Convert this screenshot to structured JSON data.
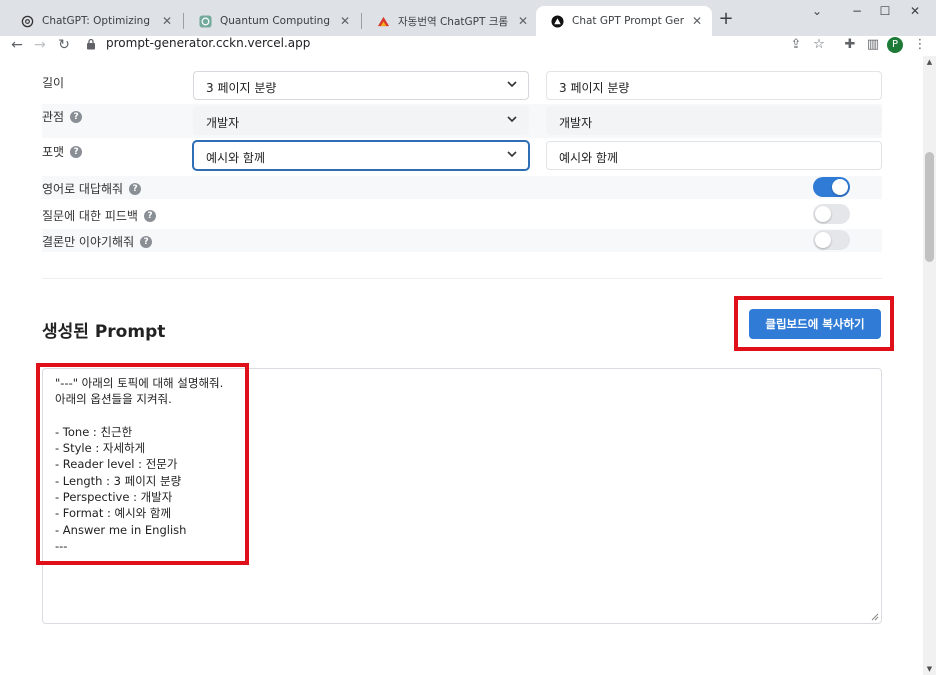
{
  "browser": {
    "tabs": [
      {
        "title": "ChatGPT: Optimizing Language",
        "icon": "openai-icon",
        "active": false
      },
      {
        "title": "Quantum Computing Simplified",
        "icon": "openai-icon",
        "active": false
      },
      {
        "title": "자동번역 ChatGPT 크롬 확장앱",
        "icon": "extension-app-icon",
        "active": false
      },
      {
        "title": "Chat GPT Prompt Generator",
        "icon": "triangle-logo-icon",
        "active": true
      }
    ],
    "url": "prompt-generator.cckn.vercel.app",
    "profile_initial": "P",
    "window_controls": [
      "⌄",
      "−",
      "☐",
      "✕"
    ]
  },
  "options": {
    "length": {
      "label": "길이",
      "value": "3 페이지 분량",
      "preview": "3 페이지 분량"
    },
    "perspective": {
      "label": "관점",
      "value": "개발자",
      "preview": "개발자"
    },
    "format": {
      "label": "포맷",
      "value": "예시와 함께",
      "preview": "예시와 함께"
    },
    "toggles": [
      {
        "label": "영어로 대답해줘",
        "on": true
      },
      {
        "label": "질문에 대한 피드백",
        "on": false
      },
      {
        "label": "결론만 이야기해줘",
        "on": false
      }
    ]
  },
  "result": {
    "title": "생성된 Prompt",
    "copy_label": "클립보드에 복사하기",
    "prompt_lines": [
      "\"---\" 아래의 토픽에 대해 설명해줘.",
      "아래의 옵션들을 지켜줘.",
      "",
      "- Tone : 친근한",
      "- Style : 자세하게",
      "- Reader level : 전문가",
      "- Length : 3 페이지 분량",
      "- Perspective : 개발자",
      "- Format : 예시와 함께",
      "- Answer me in English",
      "---"
    ]
  },
  "colors": {
    "accent": "#2f7bd6",
    "highlight": "#e0101a"
  }
}
